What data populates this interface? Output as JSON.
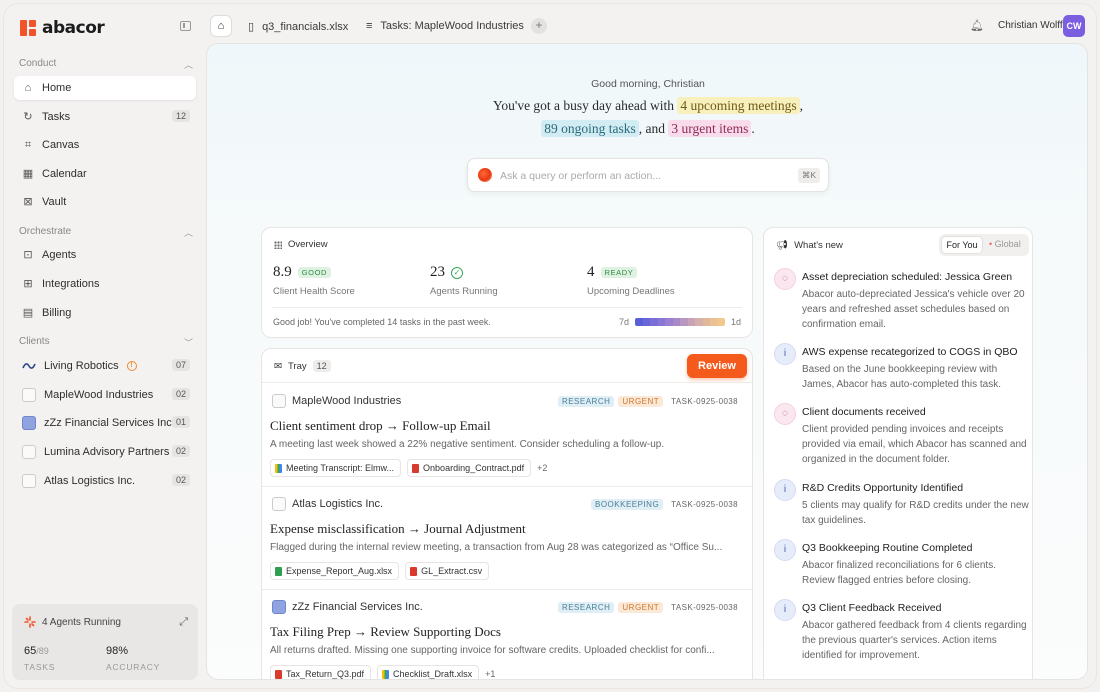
{
  "brand": {
    "name": "abacor"
  },
  "sidebar": {
    "sections": {
      "conduct": "Conduct",
      "orchestrate": "Orchestrate",
      "clients": "Clients"
    },
    "conduct": [
      {
        "label": "Home",
        "icon": "home-icon"
      },
      {
        "label": "Tasks",
        "icon": "tasks-icon",
        "count": "12"
      },
      {
        "label": "Canvas",
        "icon": "canvas-icon"
      },
      {
        "label": "Calendar",
        "icon": "calendar-icon"
      },
      {
        "label": "Vault",
        "icon": "vault-icon"
      }
    ],
    "orchestrate": [
      {
        "label": "Agents",
        "icon": "agents-icon"
      },
      {
        "label": "Integrations",
        "icon": "integrations-icon"
      },
      {
        "label": "Billing",
        "icon": "billing-icon"
      }
    ],
    "clients": [
      {
        "label": "Living Robotics",
        "count": "07"
      },
      {
        "label": "MapleWood Industries",
        "count": "02"
      },
      {
        "label": "zZz Financial Services Inc.",
        "count": "01"
      },
      {
        "label": "Lumina Advisory Partners",
        "count": "02"
      },
      {
        "label": "Atlas Logistics Inc.",
        "count": "02"
      }
    ],
    "agents_card": {
      "title": "4 Agents Running",
      "tasks_value": "65",
      "tasks_total": "/89",
      "tasks_label": "TASKS",
      "accuracy_value": "98%",
      "accuracy_label": "ACCURACY"
    }
  },
  "tabs": [
    {
      "label": "q3_financials.xlsx"
    },
    {
      "label": "Tasks: MapleWood Industries"
    }
  ],
  "user": {
    "name": "Christian Wolff",
    "initials": "CW"
  },
  "greeting": {
    "line1": "Good morning, Christian",
    "pre": "You've got a busy day ahead with",
    "meetings": "4 upcoming meetings",
    "comma": ",",
    "tasks": "89 ongoing tasks",
    "and": ", and",
    "urgent": "3 urgent items",
    "period": "."
  },
  "search": {
    "placeholder": "Ask a query or perform an action...",
    "shortcut": "⌘K"
  },
  "overview": {
    "title": "Overview",
    "stats": [
      {
        "value": "8.9",
        "tag": "GOOD",
        "label": "Client Health Score"
      },
      {
        "value": "23",
        "label": "Agents Running"
      },
      {
        "value": "4",
        "tag": "READY",
        "label": "Upcoming Deadlines"
      }
    ],
    "footer": "Good job! You've completed 14 tasks in the past week.",
    "range_start": "7d",
    "range_end": "1d",
    "heat_colors": [
      "#5a5fd6",
      "#6a66d8",
      "#7b6ed6",
      "#8a76d4",
      "#9a80d0",
      "#a98ac8",
      "#b996c0",
      "#c8a2b6",
      "#d6aeaa",
      "#e2b89c",
      "#ecc294",
      "#f2c88e"
    ]
  },
  "tray": {
    "title": "Tray",
    "count": "12",
    "review": "Review",
    "tasks": [
      {
        "client": "MapleWood Industries",
        "tags": [
          "RESEARCH",
          "URGENT"
        ],
        "id": "TASK-0925-0038",
        "title": "Client sentiment drop → Follow-up Email",
        "desc": "A meeting last week showed a 22% negative sentiment. Consider scheduling a follow-up.",
        "files": [
          {
            "name": "Meeting Transcript: Elmw...",
            "kind": "meet"
          },
          {
            "name": "Onboarding_Contract.pdf",
            "kind": "pdf"
          }
        ],
        "more": "+2"
      },
      {
        "client": "Atlas Logistics Inc.",
        "tags": [
          "BOOKKEEPING"
        ],
        "id": "TASK-0925-0038",
        "title": "Expense misclassification → Journal Adjustment",
        "desc": "Flagged during the internal review meeting, a transaction from Aug 28 was categorized as “Office Su...",
        "files": [
          {
            "name": "Expense_Report_Aug.xlsx",
            "kind": "sheet"
          },
          {
            "name": "GL_Extract.csv",
            "kind": "pdf"
          }
        ],
        "more": ""
      },
      {
        "client": "zZz Financial Services Inc.",
        "tags": [
          "RESEARCH",
          "URGENT"
        ],
        "id": "TASK-0925-0038",
        "title": "Tax Filing Prep → Review Supporting Docs",
        "desc": "All returns drafted. Missing one supporting invoice for software credits. Uploaded checklist for confi...",
        "files": [
          {
            "name": "Tax_Return_Q3.pdf",
            "kind": "pdf"
          },
          {
            "name": "Checklist_Draft.xlsx",
            "kind": "meet"
          }
        ],
        "more": "+1"
      }
    ]
  },
  "news": {
    "title": "What's new",
    "tab_on": "For You",
    "tab_off": "Global",
    "items": [
      {
        "kind": "chat",
        "title": "Asset depreciation scheduled: Jessica Green",
        "desc": "Abacor auto-depreciated Jessica's vehicle over 20 years and refreshed asset schedules based on confirmation email."
      },
      {
        "kind": "info",
        "title": "AWS expense recategorized to COGS in QBO",
        "desc": "Based on the June bookkeeping review with James, Abacor has auto-completed this task."
      },
      {
        "kind": "chat",
        "title": "Client documents received",
        "desc": "Client provided pending invoices and receipts provided via email, which Abacor has scanned and organized in the document folder."
      },
      {
        "kind": "info",
        "title": "R&D Credits Opportunity Identified",
        "desc": "5 clients may qualify for R&D credits under the new tax guidelines."
      },
      {
        "kind": "info",
        "title": "Q3 Bookkeeping Routine Completed",
        "desc": "Abacor finalized reconciliations for 6 clients. Review flagged entries before closing."
      },
      {
        "kind": "info",
        "title": "Q3 Client Feedback Received",
        "desc": "Abacor gathered feedback from 4 clients regarding the previous quarter's services. Action items identified for improvement."
      }
    ]
  }
}
